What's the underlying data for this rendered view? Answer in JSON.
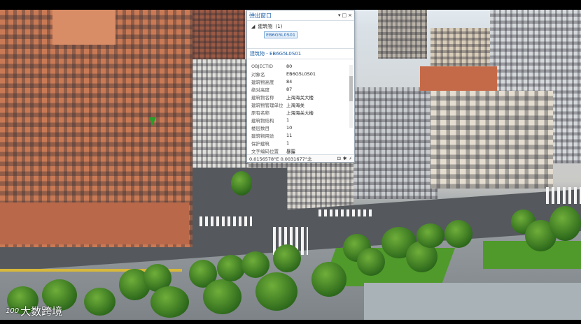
{
  "popup": {
    "title": "弹出窗口",
    "controls": [
      "▾",
      "□",
      "×"
    ],
    "layer_name": "建筑物",
    "layer_count": "(1)",
    "feature_id": "EB6G5L0S01",
    "section_title": "建筑物 - EB6G5L0S01",
    "attributes": [
      {
        "key": "OBJECTID",
        "value": "80"
      },
      {
        "key": "对象名",
        "value": "EB6G5L0S01"
      },
      {
        "key": "建筑物高度",
        "value": "84"
      },
      {
        "key": "绝对高度",
        "value": "87"
      },
      {
        "key": "建筑物名称",
        "value": "上海海关大楼"
      },
      {
        "key": "建筑物管理单位",
        "value": "上海海关"
      },
      {
        "key": "原有名称",
        "value": "上海海关大楼"
      },
      {
        "key": "建筑物结构",
        "value": "1"
      },
      {
        "key": "楼层数目",
        "value": "10"
      },
      {
        "key": "建筑物用途",
        "value": "11"
      },
      {
        "key": "保护建筑",
        "value": "1"
      },
      {
        "key": "文字编码位置",
        "value": "暴露"
      }
    ],
    "status_coords": "0.0156578°E  0.0031677°北",
    "status_icons": [
      "pin-icon",
      "gear-icon",
      "flash-icon"
    ]
  },
  "watermark": {
    "logo_text": "100",
    "brand": "大数跨境"
  },
  "colors": {
    "popup_title": "#1a5ea8",
    "brick": "#c97a55",
    "marker": "#2a9d2a"
  }
}
